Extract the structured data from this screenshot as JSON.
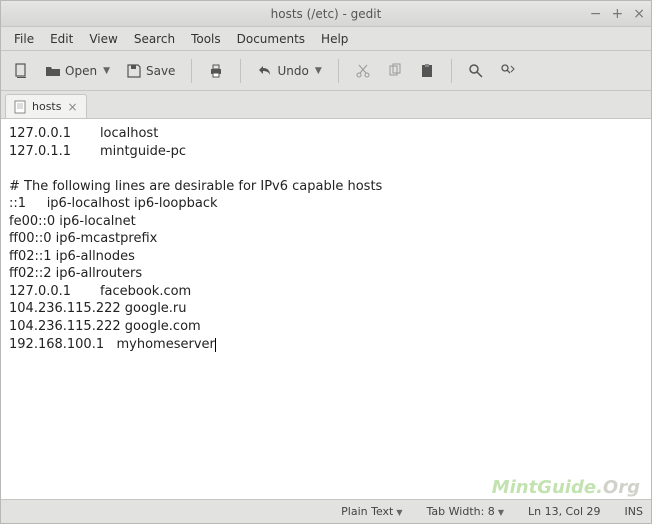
{
  "title": "hosts (/etc) - gedit",
  "menu": {
    "file": "File",
    "edit": "Edit",
    "view": "View",
    "search": "Search",
    "tools": "Tools",
    "documents": "Documents",
    "help": "Help"
  },
  "toolbar": {
    "open": "Open",
    "save": "Save",
    "undo": "Undo"
  },
  "tab": {
    "name": "hosts"
  },
  "editor_text": "127.0.0.1       localhost\n127.0.1.1       mintguide-pc\n\n# The following lines are desirable for IPv6 capable hosts\n::1     ip6-localhost ip6-loopback\nfe00::0 ip6-localnet\nff00::0 ip6-mcastprefix\nff02::1 ip6-allnodes\nff02::2 ip6-allrouters\n127.0.0.1       facebook.com\n104.236.115.222 google.ru\n104.236.115.222 google.com\n192.168.100.1   myhomeserver",
  "status": {
    "lang": "Plain Text",
    "tabwidth": "Tab Width: 8",
    "pos": "Ln 13, Col 29",
    "ins": "INS"
  },
  "watermark": {
    "a": "MintGuide.",
    "b": "Org"
  }
}
